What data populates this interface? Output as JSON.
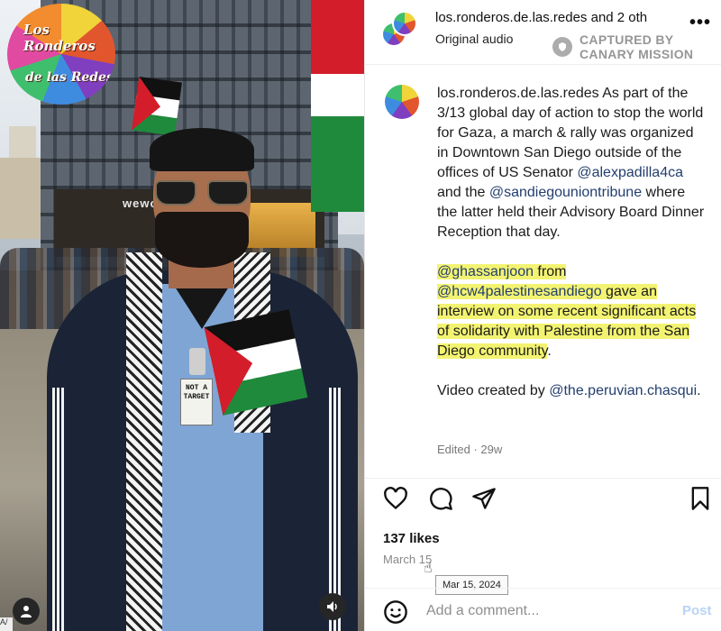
{
  "media": {
    "logo_line1": "Los Ronderos",
    "logo_line2": "de las Redes",
    "store_sign": "wewo",
    "badge_text": "NOT A TARGET",
    "corner_text": "A/"
  },
  "header": {
    "username": "los.ronderos.de.las.redes and 2 oth",
    "subtitle": "Original audio",
    "more_label": "•••",
    "watermark_line1": "CAPTURED BY",
    "watermark_line2": "CANARY MISSION"
  },
  "caption": {
    "username": "los.ronderos.de.las.redes",
    "p1_text1": " As part of the 3/13 global day of action to stop the world for Gaza, a march & rally was organized in Downtown San Diego outside of the offices of US Senator ",
    "p1_mention1": "@alexpadilla4ca",
    "p1_text2": " and the ",
    "p1_mention2": "@sandiegouniontribune",
    "p1_text3": " where the latter held their Advisory Board Dinner Reception that day.",
    "p2_mention1": "@ghassanjoon",
    "p2_text1": " from ",
    "p2_mention2": "@hcw4palestinesandiego",
    "p2_text2": " gave an interview on some recent significant acts of solidarity with Palestine from the San Diego community",
    "p2_end": ".",
    "p3_text1": "Video created by ",
    "p3_mention": "@the.peruvian.chasqui",
    "p3_end": ".",
    "edited": "Edited · 29w"
  },
  "engagement": {
    "likes": "137 likes",
    "date": "March 15",
    "tooltip": "Mar 15, 2024"
  },
  "comment": {
    "placeholder": "Add a comment...",
    "post_label": "Post"
  },
  "colors": {
    "highlight": "#f3f372",
    "mention": "#233e6e",
    "post_disabled": "#b9d3f5"
  }
}
